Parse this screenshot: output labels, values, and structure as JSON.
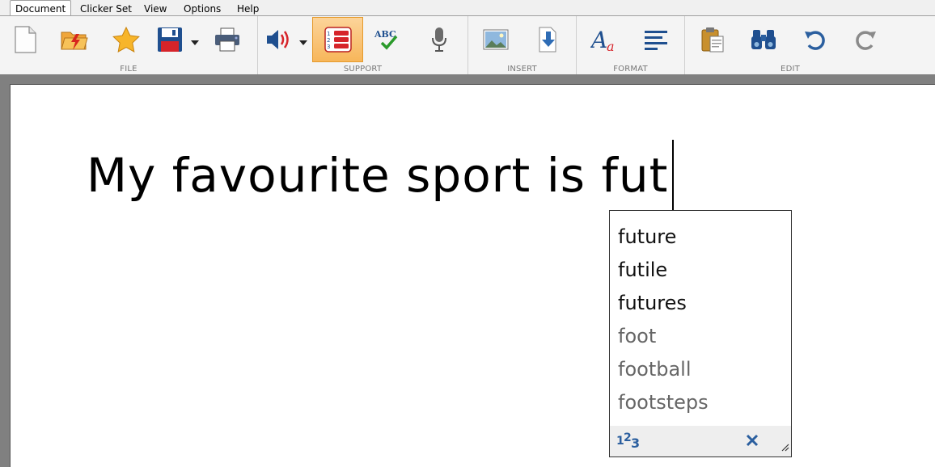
{
  "menubar": {
    "items": [
      "Document",
      "Clicker Set",
      "View",
      "Options",
      "Help"
    ]
  },
  "ribbon": {
    "groups": {
      "file": "FILE",
      "support": "SUPPORT",
      "insert": "INSERT",
      "format": "FORMAT",
      "edit": "EDIT"
    },
    "icons": {
      "new": "new-document-icon",
      "open": "open-folder-icon",
      "favourite": "favourite-star-icon",
      "save": "save-disk-icon",
      "print": "printer-icon",
      "speech": "speaker-icon",
      "predictor": "word-prediction-list-icon",
      "spellcheck": "spell-check-icon",
      "voice": "microphone-icon",
      "picture": "insert-picture-icon",
      "insert_file": "insert-file-icon",
      "font": "font-style-icon",
      "align": "align-left-icon",
      "paste": "paste-clipboard-icon",
      "find": "find-binoculars-icon",
      "undo": "undo-icon",
      "redo": "redo-icon"
    },
    "accent": "#f7b65a"
  },
  "document": {
    "text": "My favourite sport is fut"
  },
  "prediction": {
    "items": [
      {
        "word": "future",
        "strong": true
      },
      {
        "word": "futile",
        "strong": true
      },
      {
        "word": "futures",
        "strong": true
      },
      {
        "word": "foot",
        "strong": false
      },
      {
        "word": "football",
        "strong": false
      },
      {
        "word": "footsteps",
        "strong": false
      }
    ],
    "footer_icon": "numbers-123-icon",
    "close_icon": "close-icon"
  }
}
